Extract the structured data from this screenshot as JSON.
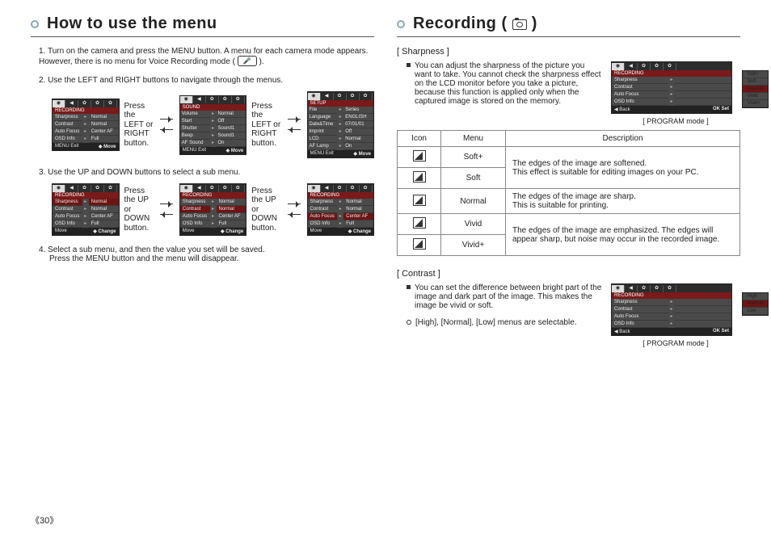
{
  "pageNumber": "《30》",
  "left": {
    "title": "How to use the menu",
    "steps": [
      {
        "num": "1.",
        "text": "Turn on the camera and press the MENU button. A menu for each camera mode appears. However, there is no menu for Voice Recording mode (",
        "tail": ")."
      },
      {
        "num": "2.",
        "text": "Use the LEFT and RIGHT buttons to navigate through the menus."
      },
      {
        "num": "3.",
        "text": "Use the UP and DOWN buttons to select a sub menu."
      },
      {
        "num": "4.",
        "text": "Select a sub menu, and then the value you set will be saved.",
        "text2": "Press the MENU button and the menu will disappear."
      }
    ],
    "hintLR": "Press the LEFT or RIGHT button.",
    "hintUD": "Press the UP or DOWN button.",
    "lcdRecording": {
      "section": "RECORDING",
      "rows": [
        [
          "Sharpness",
          "Normal"
        ],
        [
          "Contrast",
          "Normal"
        ],
        [
          "Auto Focus",
          "Center AF"
        ],
        [
          "OSD Info",
          "Full"
        ]
      ],
      "barL": "MENU Exit",
      "barR": "Move"
    },
    "lcdSound": {
      "section": "SOUND",
      "rows": [
        [
          "Volume",
          "Normal"
        ],
        [
          "Start",
          "Off"
        ],
        [
          "Shutter",
          "Sound1"
        ],
        [
          "Beep",
          "Sound1"
        ],
        [
          "AF Sound",
          "On"
        ]
      ],
      "barL": "MENU Exit",
      "barR": "Move"
    },
    "lcdSetup": {
      "section": "SETUP",
      "rows": [
        [
          "File",
          "Series"
        ],
        [
          "Language",
          "ENGLISH"
        ],
        [
          "Date&Time",
          "07/01/01"
        ],
        [
          "Imprint",
          "Off"
        ],
        [
          "LCD",
          "Normal"
        ],
        [
          "AF Lamp",
          "On"
        ]
      ],
      "barL": "MENU Exit",
      "barR": "Move"
    },
    "lcdRec2": {
      "section": "RECORDING",
      "rows": [
        [
          "Sharpness",
          "Normal"
        ],
        [
          "Contrast",
          "Normal"
        ],
        [
          "Auto Focus",
          "Center AF"
        ],
        [
          "OSD Info",
          "Full"
        ]
      ],
      "barL": "Move",
      "barR": "Change",
      "hlRow": 0
    },
    "lcdRec3": {
      "section": "RECORDING",
      "rows": [
        [
          "Sharpness",
          "Normal"
        ],
        [
          "Contrast",
          "Normal"
        ],
        [
          "Auto Focus",
          "Center AF"
        ],
        [
          "OSD Info",
          "Full"
        ]
      ],
      "barL": "Move",
      "barR": "Change",
      "hlRow": 1
    },
    "lcdRec4": {
      "section": "RECORDING",
      "rows": [
        [
          "Sharpness",
          "Normal"
        ],
        [
          "Contrast",
          "Normal"
        ],
        [
          "Auto Focus",
          "Center AF"
        ],
        [
          "OSD Info",
          "Full"
        ]
      ],
      "barL": "Move",
      "barR": "Change",
      "hlRow": 2
    }
  },
  "right": {
    "title": "Recording (      )",
    "titlePrefix": "Recording ( ",
    "titleSuffix": " )",
    "sharpness": {
      "label": "[ Sharpness ]",
      "para": "You can adjust the sharpness of the picture you want to take. You cannot check the sharpness effect on the LCD monitor before you take a picture, because this function is applied only when the captured image is stored on the memory.",
      "panel": {
        "section": "RECORDING",
        "rows": [
          [
            "Sharpness",
            ""
          ],
          [
            "Contrast",
            ""
          ],
          [
            "Auto Focus",
            ""
          ],
          [
            "OSD Info",
            ""
          ]
        ],
        "popup": [
          "Soft+",
          "Soft",
          "Normal",
          "Vivid",
          "Vivid+"
        ],
        "popupHl": 2,
        "barL": "◀  Back",
        "barR": "OK  Set",
        "caption": "[ PROGRAM mode ]"
      },
      "table": {
        "headers": [
          "Icon",
          "Menu",
          "Description"
        ],
        "rows": [
          {
            "menu": "Soft+",
            "desc": "The edges of the image are softened."
          },
          {
            "menu": "Soft",
            "desc": "This effect is suitable for editing images on your PC."
          },
          {
            "menu": "Normal",
            "desc": "The edges of the image are sharp.\nThis is suitable for printing."
          },
          {
            "menu": "Vivid",
            "desc": "The edges of the image are emphasized. The edges"
          },
          {
            "menu": "Vivid+",
            "desc": "will appear sharp, but noise may occur in the recorded image."
          }
        ]
      }
    },
    "contrast": {
      "label": "[ Contrast ]",
      "para": "You can set the difference between bright part of the image and dark part of the image. This makes the image be vivid or soft.",
      "bullet": "[High], [Normal], [Low] menus are selectable.",
      "panel": {
        "section": "RECORDING",
        "rows": [
          [
            "Sharpness",
            ""
          ],
          [
            "Contrast",
            ""
          ],
          [
            "Auto Focus",
            ""
          ],
          [
            "OSD Info",
            ""
          ]
        ],
        "popup": [
          "High",
          "Normal",
          "Low"
        ],
        "popupHl": 1,
        "barL": "◀  Back",
        "barR": "OK  Set",
        "caption": "[ PROGRAM mode ]"
      }
    }
  }
}
